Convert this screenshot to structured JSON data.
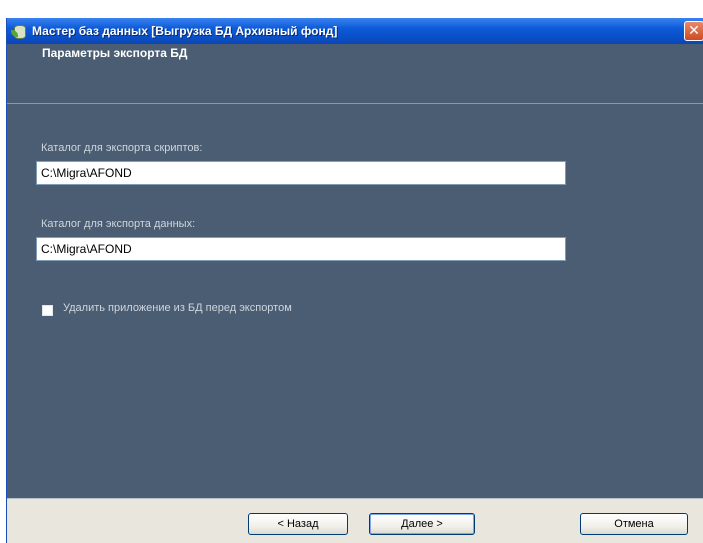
{
  "window": {
    "title": "Мастер баз данных [Выгрузка БД Архивный фонд]",
    "close_glyph": "✕",
    "app_icon": "database-icon"
  },
  "header": {
    "title": "Параметры экспорта БД"
  },
  "form": {
    "scripts_dir": {
      "label": "Каталог для экспорта скриптов:",
      "value": "C:\\Migra\\AFOND"
    },
    "data_dir": {
      "label": "Каталог для экспорта данных:",
      "value": "C:\\Migra\\AFOND"
    },
    "delete_app": {
      "label": "Удалить приложение из БД перед экспортом",
      "checked": false
    }
  },
  "footer": {
    "back_label": "< Назад",
    "next_label": "Далее >",
    "cancel_label": "Отмена"
  },
  "colors": {
    "titlebar": "#0a4fc7",
    "body_background": "#4a5d72",
    "footer_background": "#e8e6dd",
    "close_button": "#cf4a22"
  }
}
